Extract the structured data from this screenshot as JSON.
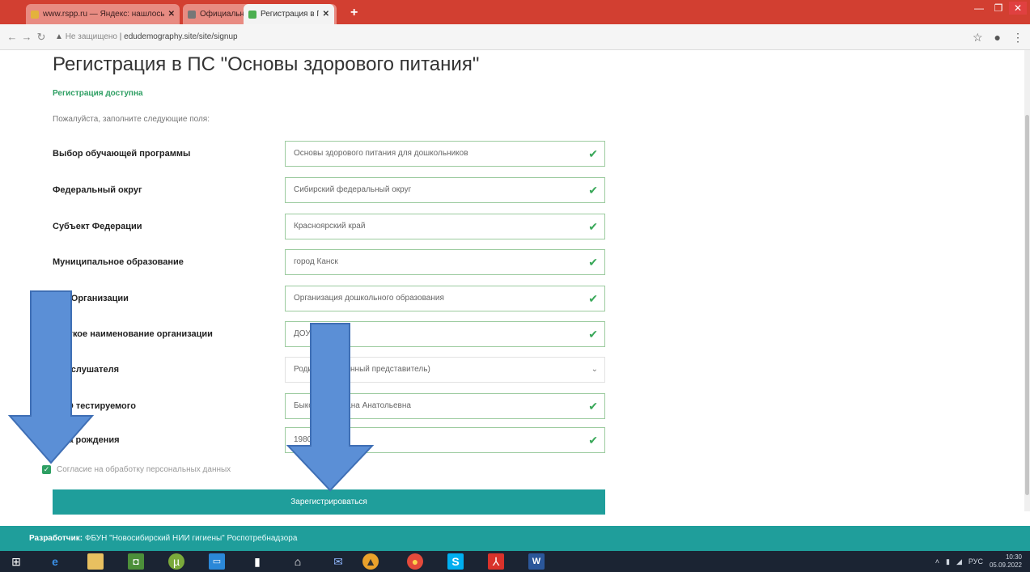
{
  "browser": {
    "tabs": [
      {
        "title": "www.rspp.ru — Яндекс: нашлось",
        "favicon_color": "#e3b23c"
      },
      {
        "title": "Официальный сайт Новосибир",
        "favicon_color": "#666666"
      },
      {
        "title": "Регистрация в ПС \"Основы здо",
        "favicon_color": "#4caf50"
      }
    ],
    "new_tab_symbol": "+",
    "address": {
      "security": "Не защищено",
      "url": "edudemography.site/site/signup"
    }
  },
  "page": {
    "title": "Регистрация в ПС \"Основы здорового питания\"",
    "status": "Регистрация доступна",
    "instruction": "Пожалуйста, заполните следующие поля:",
    "fields": [
      {
        "label": "Выбор обучающей программы",
        "value": "Основы здорового питания для дошкольников",
        "validated": true
      },
      {
        "label": "Федеральный округ",
        "value": "Сибирский федеральный округ",
        "validated": true
      },
      {
        "label": "Субъект Федерации",
        "value": "Красноярский край",
        "validated": true
      },
      {
        "label": "Муниципальное образование",
        "value": "город Канск",
        "validated": true
      },
      {
        "label": "Тип Организации",
        "value": "Организация дошкольного образования",
        "validated": true
      },
      {
        "label": "Краткое наименование организации",
        "value": "ДОУ",
        "validated": true
      },
      {
        "label": "Тип слушателя",
        "value": "Родитель (законный представитель)",
        "validated": false
      },
      {
        "label": "ФИО тестируемого",
        "value": "Быкова Светлана Анатольевна",
        "validated": true
      },
      {
        "label": "Дата рождения",
        "value": "1980",
        "validated": true
      }
    ],
    "consent_label": "Согласие на обработку персональных данных",
    "consent_checked": true,
    "submit_label": "Зарегистрироваться",
    "check_symbol": "✔",
    "dropdown_symbol": "⌄"
  },
  "footer": {
    "prefix": "Разработчик:",
    "text": "ФБУН \"Новосибирский НИИ гигиены\" Роспотребнадзора"
  },
  "taskbar": {
    "tray_lang": "РУС",
    "clock_time": "10:30",
    "clock_date": "05.09.2022"
  },
  "colors": {
    "accent": "#1f9e9b",
    "valid_green": "#2e9f63",
    "arrow_blue": "#5b8fd6"
  }
}
